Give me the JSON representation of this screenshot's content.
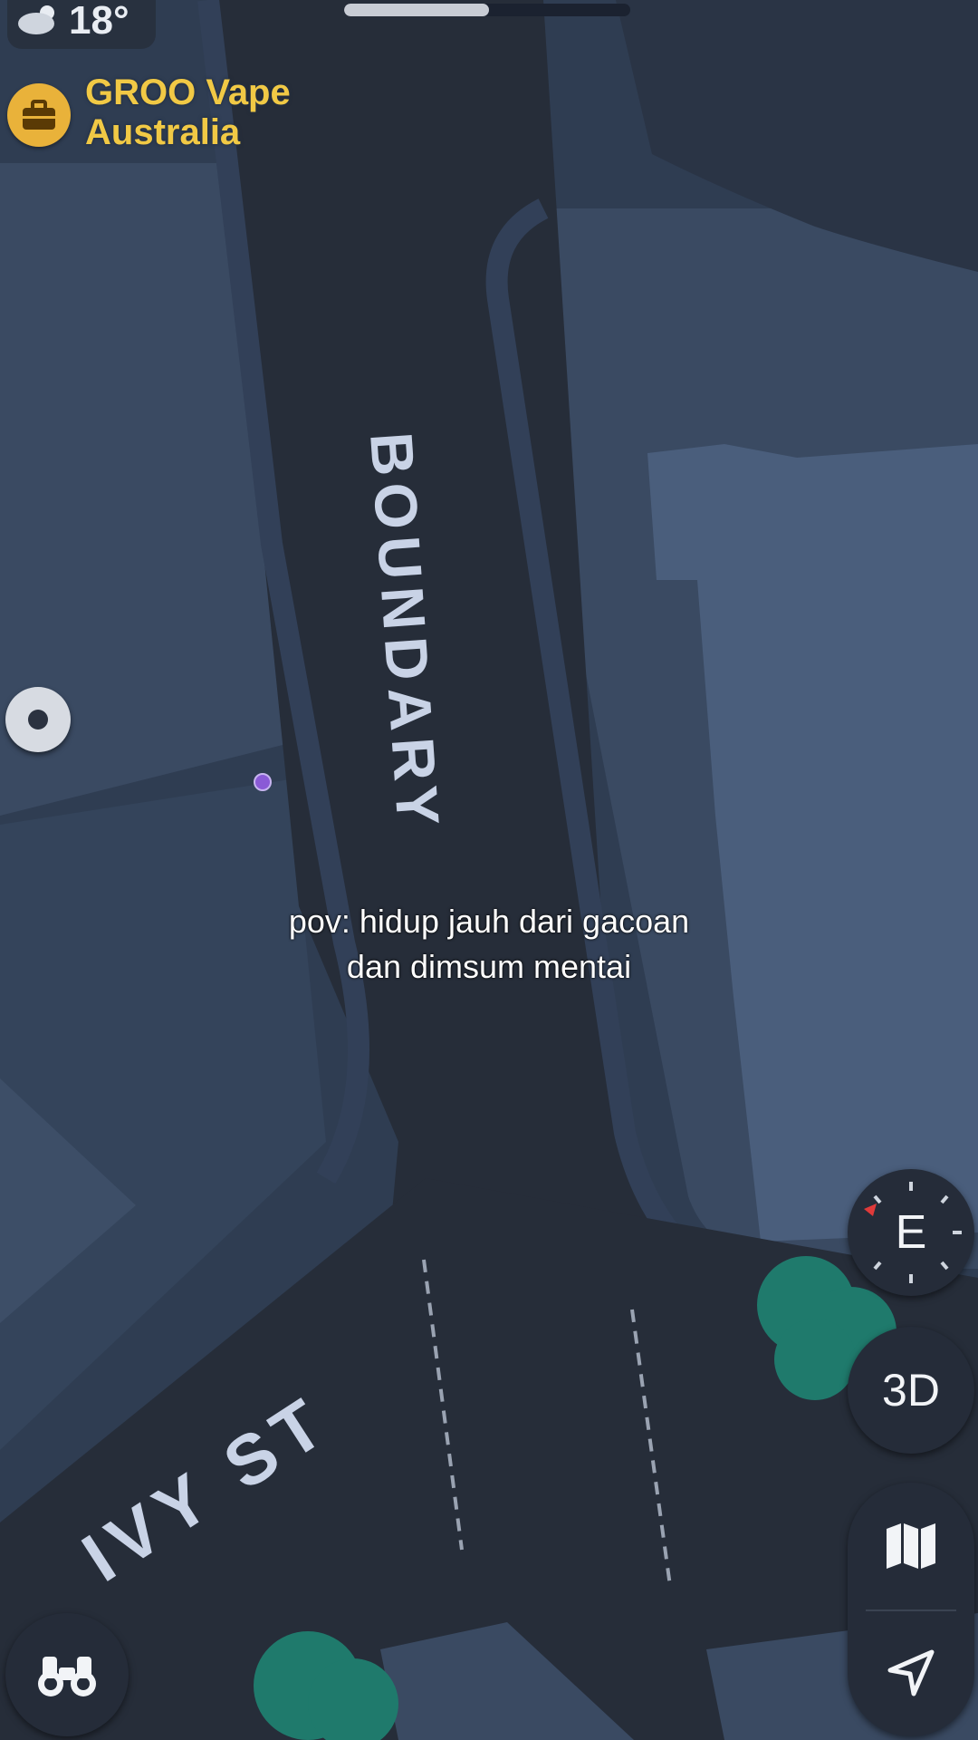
{
  "status": {
    "temperature": "18°",
    "weather_icon": "partly-cloudy-icon"
  },
  "map": {
    "poi": {
      "name": "GROO Vape\nAustralia",
      "icon": "briefcase-icon",
      "color": "#f1c945"
    },
    "streets": {
      "boundary": "BOUNDARY",
      "ivy": "IVY ST"
    },
    "colors": {
      "road": "#262d39",
      "block": "#3a4a62",
      "building": "#4a5e7c",
      "tree": "#1f7a6c"
    }
  },
  "caption": {
    "line1": "pov: hidup jauh dari gacoan",
    "line2": "dan dimsum mentai"
  },
  "controls": {
    "compass_heading": "E",
    "view_3d": "3D",
    "map_mode_icon": "map-icon",
    "location_icon": "location-arrow-icon",
    "look_around_icon": "binoculars-icon"
  }
}
